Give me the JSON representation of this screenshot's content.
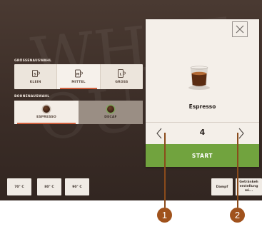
{
  "background_word": "WHAT\nOU",
  "size_section": {
    "label": "GRÖSSENAUSWAHL",
    "options": [
      {
        "label": "KLEIN",
        "icon": "small-cup-icon",
        "selected": false
      },
      {
        "label": "MITTEL",
        "icon": "medium-cup-icon",
        "selected": true
      },
      {
        "label": "GROSS",
        "icon": "large-cup-icon",
        "selected": false
      }
    ]
  },
  "bean_section": {
    "label": "BOHNENAUSWAHL",
    "options": [
      {
        "label": "ESPRESSO",
        "icon": "espresso-bean-icon",
        "selected": true
      },
      {
        "label": "DECAF",
        "icon": "decaf-bean-icon",
        "selected": false
      }
    ]
  },
  "panel": {
    "close_icon": "close-icon",
    "drink_icon": "espresso-cup-icon",
    "drink_name": "Espresso",
    "quantity": "4",
    "prev_icon": "chevron-left-icon",
    "next_icon": "chevron-right-icon",
    "start_label": "START"
  },
  "temperatures": [
    "70° C",
    "80° C",
    "90° C"
  ],
  "steam_label": "Dampf",
  "maker_label": [
    "Getränkeh",
    "erstellung",
    "mi..."
  ],
  "markers": [
    "1",
    "2"
  ],
  "colors": {
    "start_green": "#71a33e",
    "selection_accent": "#d1613e",
    "marker_brown": "#a0521c"
  }
}
